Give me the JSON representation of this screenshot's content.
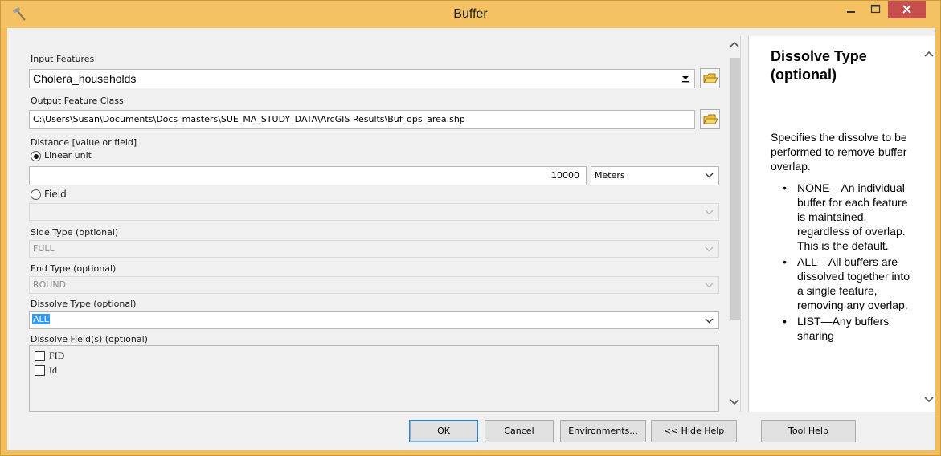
{
  "window": {
    "title": "Buffer",
    "titlebar_color": "#f4c163",
    "close_color": "#c7504f"
  },
  "form": {
    "input_features": {
      "label": "Input Features",
      "value": "Cholera_households"
    },
    "output_feature_class": {
      "label": "Output Feature Class",
      "value": "C:\\Users\\Susan\\Documents\\Docs_masters\\SUE_MA_STUDY_DATA\\ArcGIS Results\\Buf_ops_area.shp"
    },
    "distance": {
      "label": "Distance [value or field]",
      "linear_unit_label": "Linear unit",
      "linear_unit_selected": true,
      "value": "10000",
      "unit": "Meters",
      "field_label": "Field",
      "field_value": ""
    },
    "side_type": {
      "label": "Side Type (optional)",
      "value": "FULL"
    },
    "end_type": {
      "label": "End Type (optional)",
      "value": "ROUND"
    },
    "dissolve_type": {
      "label": "Dissolve Type (optional)",
      "value": "ALL"
    },
    "dissolve_fields": {
      "label": "Dissolve Field(s) (optional)",
      "items": [
        "FID",
        "Id"
      ]
    }
  },
  "help": {
    "title": "Dissolve Type (optional)",
    "description": "Specifies the dissolve to be performed to remove buffer overlap.",
    "items": [
      "NONE—An individual buffer for each feature is maintained, regardless of overlap. This is the default.",
      "ALL—All buffers are dissolved together into a single feature, removing any overlap.",
      "LIST—Any buffers sharing"
    ]
  },
  "buttons": {
    "ok": "OK",
    "cancel": "Cancel",
    "environments": "Environments...",
    "hide_help": "<< Hide Help",
    "tool_help": "Tool Help"
  },
  "icons": {
    "app": "hammer-icon",
    "minimize": "minimize-icon",
    "maximize": "maximize-icon",
    "close": "close-icon",
    "browse": "folder-open-icon",
    "dropdown": "chevron-down-icon",
    "scroll_up": "chevron-up-icon",
    "scroll_down": "chevron-down-icon"
  }
}
